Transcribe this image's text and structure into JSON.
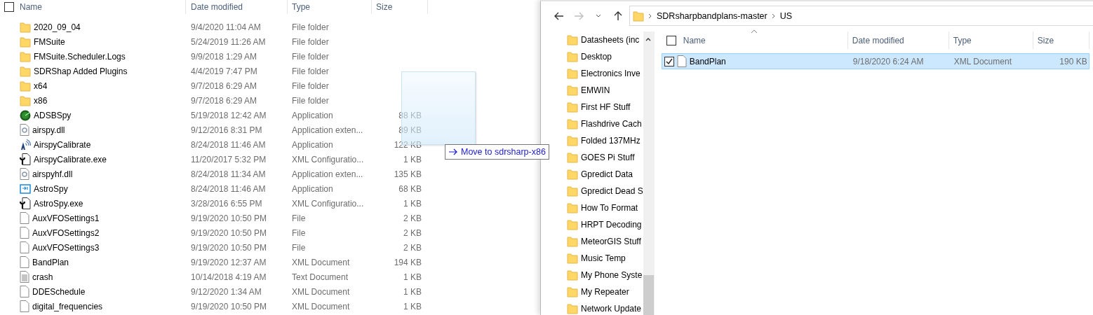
{
  "left_pane": {
    "select_all_checked": false,
    "columns": [
      {
        "label": "Name"
      },
      {
        "label": "Date modified"
      },
      {
        "label": "Type"
      },
      {
        "label": "Size"
      }
    ],
    "rows": [
      {
        "kind": "folder",
        "name": "2020_09_04",
        "date": "9/4/2020 11:04 AM",
        "type": "File folder",
        "selected": false
      },
      {
        "kind": "folder",
        "name": "FMSuite",
        "date": "5/24/2019 11:26 AM",
        "type": "File folder",
        "selected": false
      },
      {
        "kind": "folder",
        "name": "FMSuite.Scheduler.Logs",
        "date": "9/9/2018 1:29 AM",
        "type": "File folder",
        "selected": false
      },
      {
        "kind": "folder",
        "name": "SDRShap Added Plugins",
        "date": "4/4/2019 7:47 PM",
        "type": "File folder",
        "selected": false
      },
      {
        "kind": "folder",
        "name": "x64",
        "date": "9/7/2018 6:29 AM",
        "type": "File folder",
        "selected": false
      },
      {
        "kind": "folder",
        "name": "x86",
        "date": "9/7/2018 6:29 AM",
        "type": "File folder",
        "selected": false
      },
      {
        "kind": "radar",
        "name": "ADSBSpy",
        "date": "5/19/2018 12:42 AM",
        "type": "Application",
        "size": "88 KB",
        "selected": false
      },
      {
        "kind": "dll",
        "name": "airspy.dll",
        "date": "9/12/2016 8:31 PM",
        "type": "Application exten...",
        "size": "89 KB",
        "selected": false
      },
      {
        "kind": "antenna",
        "name": "AirspyCalibrate",
        "date": "8/24/2018 11:46 AM",
        "type": "Application",
        "size": "122 KB",
        "selected": false
      },
      {
        "kind": "config",
        "name": "AirspyCalibrate.exe",
        "date": "11/20/2017 5:32 PM",
        "type": "XML Configuratio...",
        "size": "1 KB",
        "selected": false
      },
      {
        "kind": "dll",
        "name": "airspyhf.dll",
        "date": "8/24/2018 11:34 AM",
        "type": "Application exten...",
        "size": "135 KB",
        "selected": false
      },
      {
        "kind": "window",
        "name": "AstroSpy",
        "date": "8/24/2018 11:46 AM",
        "type": "Application",
        "size": "68 KB",
        "selected": false
      },
      {
        "kind": "config",
        "name": "AstroSpy.exe",
        "date": "3/28/2016 6:55 PM",
        "type": "XML Configuratio...",
        "size": "1 KB",
        "selected": false
      },
      {
        "kind": "file",
        "name": "AuxVFOSettings1",
        "date": "9/19/2020 10:50 PM",
        "type": "File",
        "size": "2 KB",
        "selected": false
      },
      {
        "kind": "file",
        "name": "AuxVFOSettings2",
        "date": "9/19/2020 10:50 PM",
        "type": "File",
        "size": "2 KB",
        "selected": false
      },
      {
        "kind": "file",
        "name": "AuxVFOSettings3",
        "date": "9/19/2020 10:50 PM",
        "type": "File",
        "size": "2 KB",
        "selected": false
      },
      {
        "kind": "file",
        "name": "BandPlan",
        "date": "9/19/2020 12:37 AM",
        "type": "XML Document",
        "size": "194 KB",
        "selected": false
      },
      {
        "kind": "text",
        "name": "crash",
        "date": "10/14/2018 4:19 AM",
        "type": "Text Document",
        "size": "1 KB",
        "selected": false
      },
      {
        "kind": "file",
        "name": "DDESchedule",
        "date": "9/12/2020 1:34 AM",
        "type": "XML Document",
        "size": "1 KB",
        "selected": false
      },
      {
        "kind": "file",
        "name": "digital_frequencies",
        "date": "9/19/2020 10:50 PM",
        "type": "XML Document",
        "size": "1 KB",
        "selected": false
      }
    ]
  },
  "drag_tooltip": {
    "label": "Move to sdrsharp-x86"
  },
  "right_window": {
    "navigation": {
      "back": {
        "disabled": false
      },
      "forward": {
        "disabled": true
      }
    },
    "breadcrumbs": [
      "SDRsharpbandplans-master",
      "US"
    ],
    "nav_items": [
      {
        "label": "Datasheets (inc"
      },
      {
        "label": "Desktop"
      },
      {
        "label": "Electronics Inve"
      },
      {
        "label": "EMWIN"
      },
      {
        "label": "First HF Stuff"
      },
      {
        "label": "Flashdrive Cach"
      },
      {
        "label": "Folded 137MHz"
      },
      {
        "label": "GOES Pi Stuff"
      },
      {
        "label": "Gpredict Data"
      },
      {
        "label": "Gpredict Dead S"
      },
      {
        "label": "How To Format"
      },
      {
        "label": "HRPT Decoding"
      },
      {
        "label": "MeteorGIS Stuff"
      },
      {
        "label": "Music Temp"
      },
      {
        "label": "My Phone Syste"
      },
      {
        "label": "My Repeater"
      },
      {
        "label": "Network Update"
      }
    ],
    "select_all_checked": false,
    "columns": [
      {
        "label": "Name",
        "sorted": true
      },
      {
        "label": "Date modified",
        "sorted": false
      },
      {
        "label": "Type",
        "sorted": false
      },
      {
        "label": "Size",
        "sorted": false
      }
    ],
    "rows": [
      {
        "kind": "file",
        "name": "BandPlan",
        "date": "9/18/2020 6:24 AM",
        "type": "XML Document",
        "size": "190 KB",
        "selected": true
      }
    ]
  }
}
